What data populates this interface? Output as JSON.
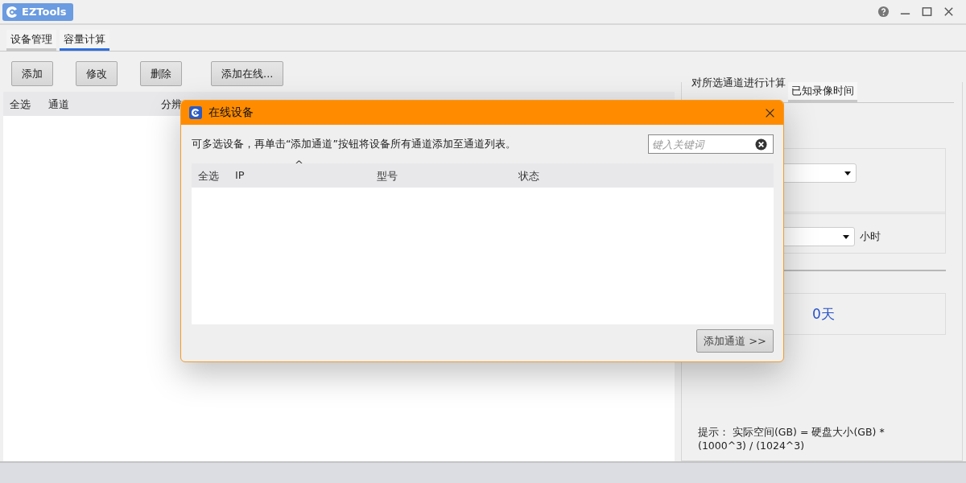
{
  "window": {
    "title": "EZTools",
    "controls": [
      {
        "kind": "help"
      },
      {
        "kind": "minimize"
      },
      {
        "kind": "maximize"
      },
      {
        "kind": "close"
      }
    ]
  },
  "tabs": [
    {
      "label": "设备管理",
      "selected": false
    },
    {
      "label": "容量计算",
      "selected": true
    }
  ],
  "toolbar": [
    "添加",
    "修改",
    "删除",
    "添加在线..."
  ],
  "table": {
    "columns": [
      "全选",
      "通道",
      "分辨"
    ]
  },
  "calc": {
    "title": "对所选通道进行计算",
    "tabs": [
      {
        "label": "已知录像时间",
        "selected": true
      }
    ],
    "hours_dropdown": {
      "unit": "小时"
    },
    "result": "0天",
    "hint": "提示： 实际空间(GB) = 硬盘大小(GB) * (1000^3) / (1024^3)"
  },
  "dialog": {
    "title": "在线设备",
    "instruction": "可多选设备，再单击“添加通道”按钮将设备所有通道添加至通道列表。",
    "search": {
      "placeholder": "键入关键词"
    },
    "columns": [
      "全选",
      "IP",
      "型号",
      "状态"
    ],
    "sort_mark": "^",
    "button": "添加通道 >>"
  }
}
